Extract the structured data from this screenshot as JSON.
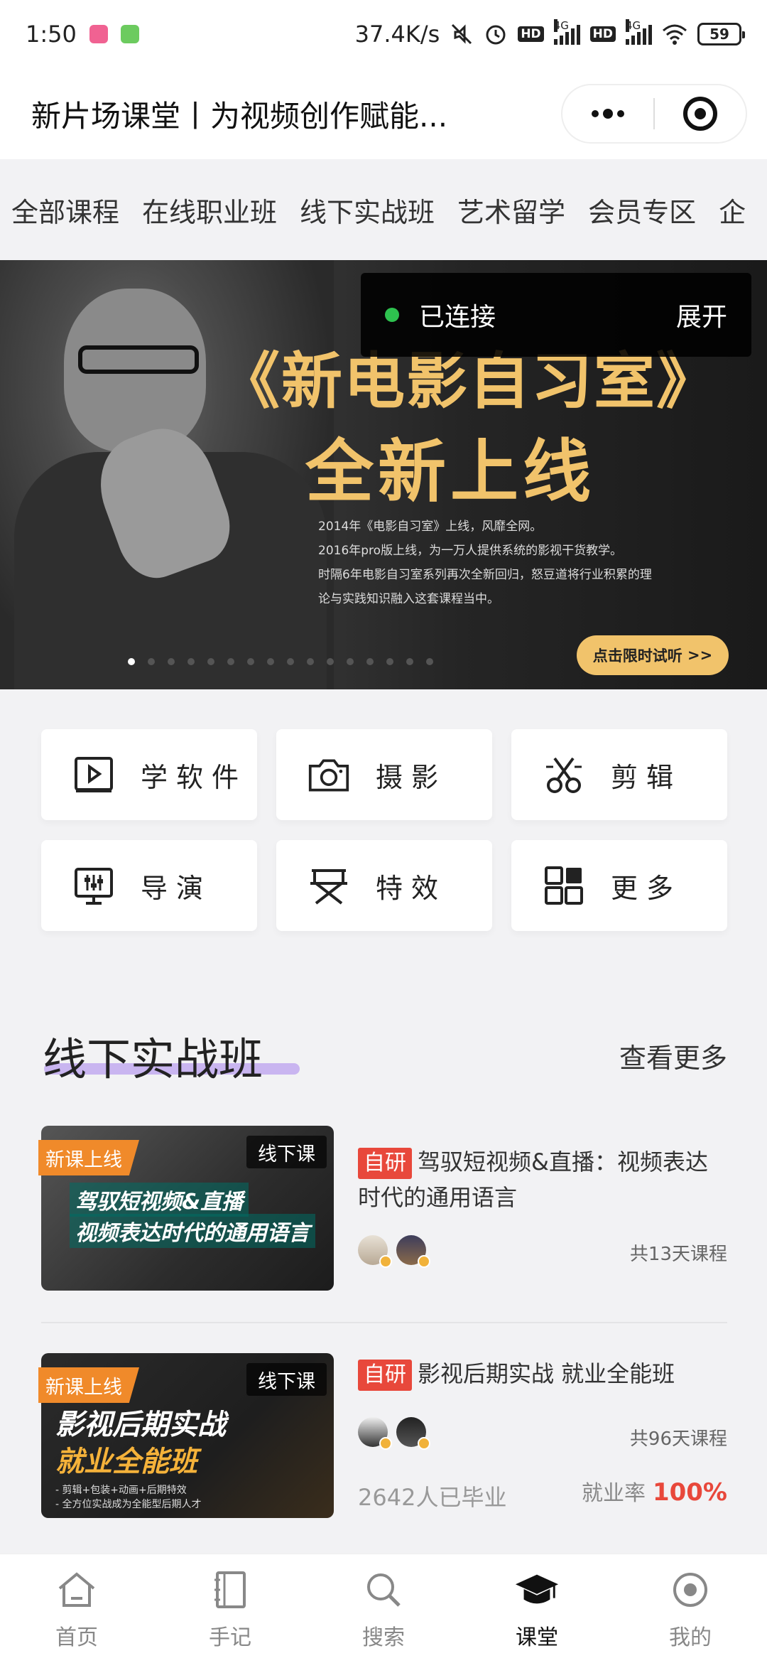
{
  "status_bar": {
    "time": "1:50",
    "net_speed": "37.4K/s",
    "sim1_net": "4G",
    "sim2_net": "4G",
    "hd1": "HD",
    "hd2": "HD",
    "battery": "59"
  },
  "title_bar": {
    "title": "新片场课堂丨为视频创作赋能..."
  },
  "category_tabs": [
    "全部课程",
    "在线职业班",
    "线下实战班",
    "艺术留学",
    "会员专区",
    "企"
  ],
  "banner": {
    "heading": "《新电影自习室》",
    "subheading": "全新上线",
    "body_lines": [
      "2014年《电影自习室》上线，风靡全网。",
      "2016年pro版上线，为一万人提供系统的影视干货教学。",
      "时隔6年电影自习室系列再次全新回归，怒豆道将行业积累的理",
      "论与实践知识融入这套课程当中。"
    ],
    "cta": "点击限时试听",
    "active_index": 0
  },
  "connection": {
    "status": "已连接",
    "action": "展开",
    "status_color": "#2ec24f"
  },
  "quick_entries": [
    {
      "label": "学软件",
      "icon": "play-video-icon"
    },
    {
      "label": "摄影",
      "icon": "camera-icon"
    },
    {
      "label": "剪辑",
      "icon": "scissors-icon"
    },
    {
      "label": "导演",
      "icon": "monitor-icon"
    },
    {
      "label": "特效",
      "icon": "director-chair-icon"
    },
    {
      "label": "更多",
      "icon": "grid-icon"
    }
  ],
  "section": {
    "title": "线下实战班",
    "more": "查看更多",
    "underline_color": "#c9b5f0"
  },
  "courses": [
    {
      "tag_new": "新课上线",
      "tag_type": "线下课",
      "thumb_line1": "驾驭短视频&直播",
      "thumb_line2": "视频表达时代的通用语言",
      "badge": "自研",
      "title": "驾驭短视频&直播：视频表达时代的通用语言",
      "days": "共13天课程"
    },
    {
      "tag_new": "新课上线",
      "tag_type": "线下课",
      "thumb_line1": "影视后期实战",
      "thumb_line2": "就业全能班",
      "thumb_bullets": [
        "- 剪辑+包装+动画+后期特效",
        "- 全方位实战成为全能型后期人才"
      ],
      "badge": "自研",
      "title": "影视后期实战 就业全能班",
      "days": "共96天课程",
      "grads": "2642人已毕业",
      "rate_label": "就业率",
      "rate_value": "100%"
    }
  ],
  "tabbar": [
    {
      "label": "首页",
      "icon": "home-icon",
      "active": false
    },
    {
      "label": "手记",
      "icon": "notebook-icon",
      "active": false
    },
    {
      "label": "搜索",
      "icon": "search-icon",
      "active": false
    },
    {
      "label": "课堂",
      "icon": "graduation-cap-icon",
      "active": true
    },
    {
      "label": "我的",
      "icon": "profile-icon",
      "active": false
    }
  ],
  "colors": {
    "accent_red": "#e8483b",
    "tag_orange": "#f08a2a",
    "banner_gold": "#f1c36b"
  }
}
